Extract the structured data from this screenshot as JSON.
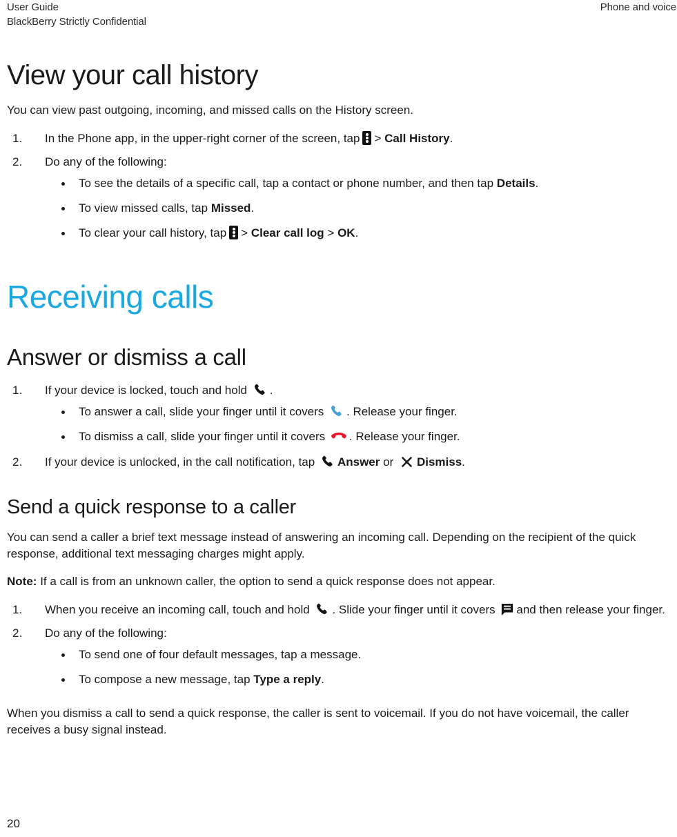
{
  "header": {
    "left_line1": "User Guide",
    "left_line2": "BlackBerry Strictly Confidential",
    "right": "Phone and voice"
  },
  "colors": {
    "chapter_blue": "#19a8e0",
    "answer_phone_blue": "#4a9fd5",
    "end_call_red": "#e8152b",
    "text": "#1b1b1b"
  },
  "icons": {
    "overflow": "overflow-menu-icon",
    "phone_black": "phone-handset-icon",
    "phone_blue": "answer-call-icon",
    "phone_red": "end-call-icon",
    "dismiss_x": "close-x-icon",
    "message": "message-bubble-icon"
  },
  "sections": {
    "call_history": {
      "title": "View your call history",
      "intro": "You can view past outgoing, incoming, and missed calls on the History screen.",
      "step1": {
        "text_before": "In the Phone app, in the upper-right corner of the screen, tap",
        "separator": ">",
        "bold_target": "Call History",
        "text_after": "."
      },
      "step2": "Do any of the following:",
      "bullets": [
        {
          "text_before": "To see the details of a specific call, tap a contact or phone number, and then tap",
          "bold": "Details",
          "text_after": "."
        },
        {
          "text_before": "To view missed calls, tap",
          "bold": "Missed",
          "text_after": "."
        },
        {
          "text_before": "To clear your call history, tap",
          "sep1": ">",
          "bold1": "Clear call log",
          "sep2": ">",
          "bold2": "OK",
          "text_after": "."
        }
      ]
    },
    "receiving_calls": {
      "title": "Receiving calls"
    },
    "answer_dismiss": {
      "title": "Answer or dismiss a call",
      "step1_before": "If your device is locked, touch and hold",
      "step1_after": ".",
      "bullets": [
        {
          "before": "To answer a call, slide your finger until it covers",
          "after": ". Release your finger."
        },
        {
          "before": "To dismiss a call, slide your finger until it covers",
          "after": ". Release your finger."
        }
      ],
      "step2_before": "If your device is unlocked, in the call notification, tap",
      "step2_answer": "Answer",
      "step2_or": "or",
      "step2_dismiss": "Dismiss",
      "step2_after": "."
    },
    "quick_response": {
      "title": "Send a quick response to a caller",
      "intro": "You can send a caller a brief text message instead of answering an incoming call. Depending on the recipient of the quick response, additional text messaging charges might apply.",
      "note_label": "Note:",
      "note_text": "If a call is from an unknown caller, the option to send a quick response does not appear.",
      "step1_before": "When you receive an incoming call, touch and hold",
      "step1_mid": ". Slide your finger until it covers",
      "step1_after": "and then release your finger.",
      "step2": "Do any of the following:",
      "bullets": [
        {
          "before": "To send one of four default messages, tap a message.",
          "bold": "",
          "after": ""
        },
        {
          "before": "To compose a new message, tap",
          "bold": "Type a reply",
          "after": "."
        }
      ],
      "closing": "When you dismiss a call to send a quick response, the caller is sent to voicemail. If you do not have voicemail, the caller receives a busy signal instead."
    }
  },
  "footer": {
    "page_number": "20"
  }
}
